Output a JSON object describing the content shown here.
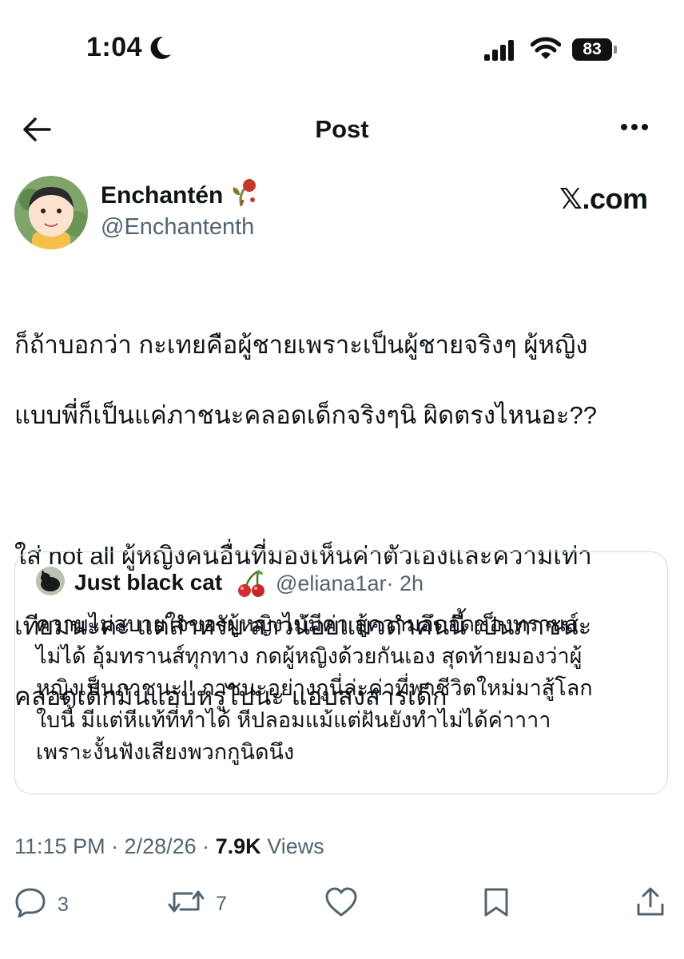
{
  "status_bar": {
    "time": "1:04",
    "battery": "83"
  },
  "header": {
    "title": "Post"
  },
  "author": {
    "display_name": "Enchantén",
    "handle": "@Enchantenth",
    "source_badge": "𝕏.com"
  },
  "post": {
    "lines_p1": [
      "ก็ถ้าบอกว่า กะเทยคือผู้ชายเพราะเป็นผู้ชายจริงๆ ผู้หญิง",
      "แบบพี่ก็เป็นแค่ภาชนะคลอดเด็กจริงๆนิ ผิดตรงไหนอะ??"
    ],
    "lines_p2": [
      "ใส่ not all ผู้หญิงคนอื่นที่มองเห็นค่าตัวเองและความเท่า",
      "เทียมนะคะ แต่สำหรับ สาวน้อยแมวดำคนนี้ เป็นภาชนะ",
      "คลอดเด็กมันแอบหรูไปนะ แอบสงสารเด็ก"
    ]
  },
  "quote": {
    "display_name": "Just black cat",
    "handle": "@eliana1ar",
    "time": "· 2h",
    "lines": [
      "ความไม่สบายใจของผู้หญิงไม่มีค่า สู้ความอึดอัดของทรานส์",
      "ไม่ได้ อุ้มทรานส์ทุกทาง กดผู้หญิงด้วยกันเอง สุดท้ายมองว่าผู้",
      "หญิงเป็นภาชนะ!! ภาชนะอย่างกูนี่ล่ะค่าที่พาชีวิตใหม่มาสู้โลก",
      "ใบนี้ มีแต่หีแท้ที่ทำได้ หีปลอมแม้แต่ฝันยังทำไม่ได้ค่าาาา",
      "เพราะงั้นฟังเสียงพวกกูนิดนึง"
    ]
  },
  "meta": {
    "timestamp": "11:15 PM · 2/28/26 · ",
    "views_count": "7.9K",
    "views_label": " Views"
  },
  "actions": {
    "replies": "3",
    "reposts": "7"
  }
}
